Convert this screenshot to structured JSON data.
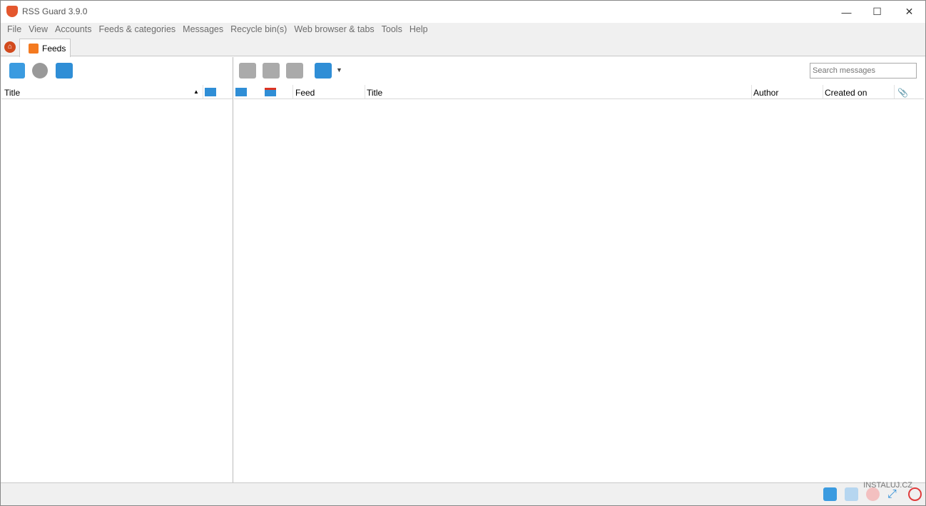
{
  "window": {
    "title": "RSS Guard 3.9.0",
    "minimize": "—",
    "maximize": "☐",
    "close": "✕"
  },
  "menu": [
    "File",
    "View",
    "Accounts",
    "Feeds & categories",
    "Messages",
    "Recycle bin(s)",
    "Web browser & tabs",
    "Tools",
    "Help"
  ],
  "tabs": {
    "feeds": "Feeds"
  },
  "feeds_list": {
    "columns": {
      "title": "Title"
    }
  },
  "messages_list": {
    "search_placeholder": "Search messages",
    "columns": {
      "feed": "Feed",
      "title": "Title",
      "author": "Author",
      "created_on": "Created on"
    }
  },
  "watermark": "INSTALUJ.CZ",
  "colors": {
    "accent": "#2f8ed6",
    "brand": "#e4572e"
  }
}
